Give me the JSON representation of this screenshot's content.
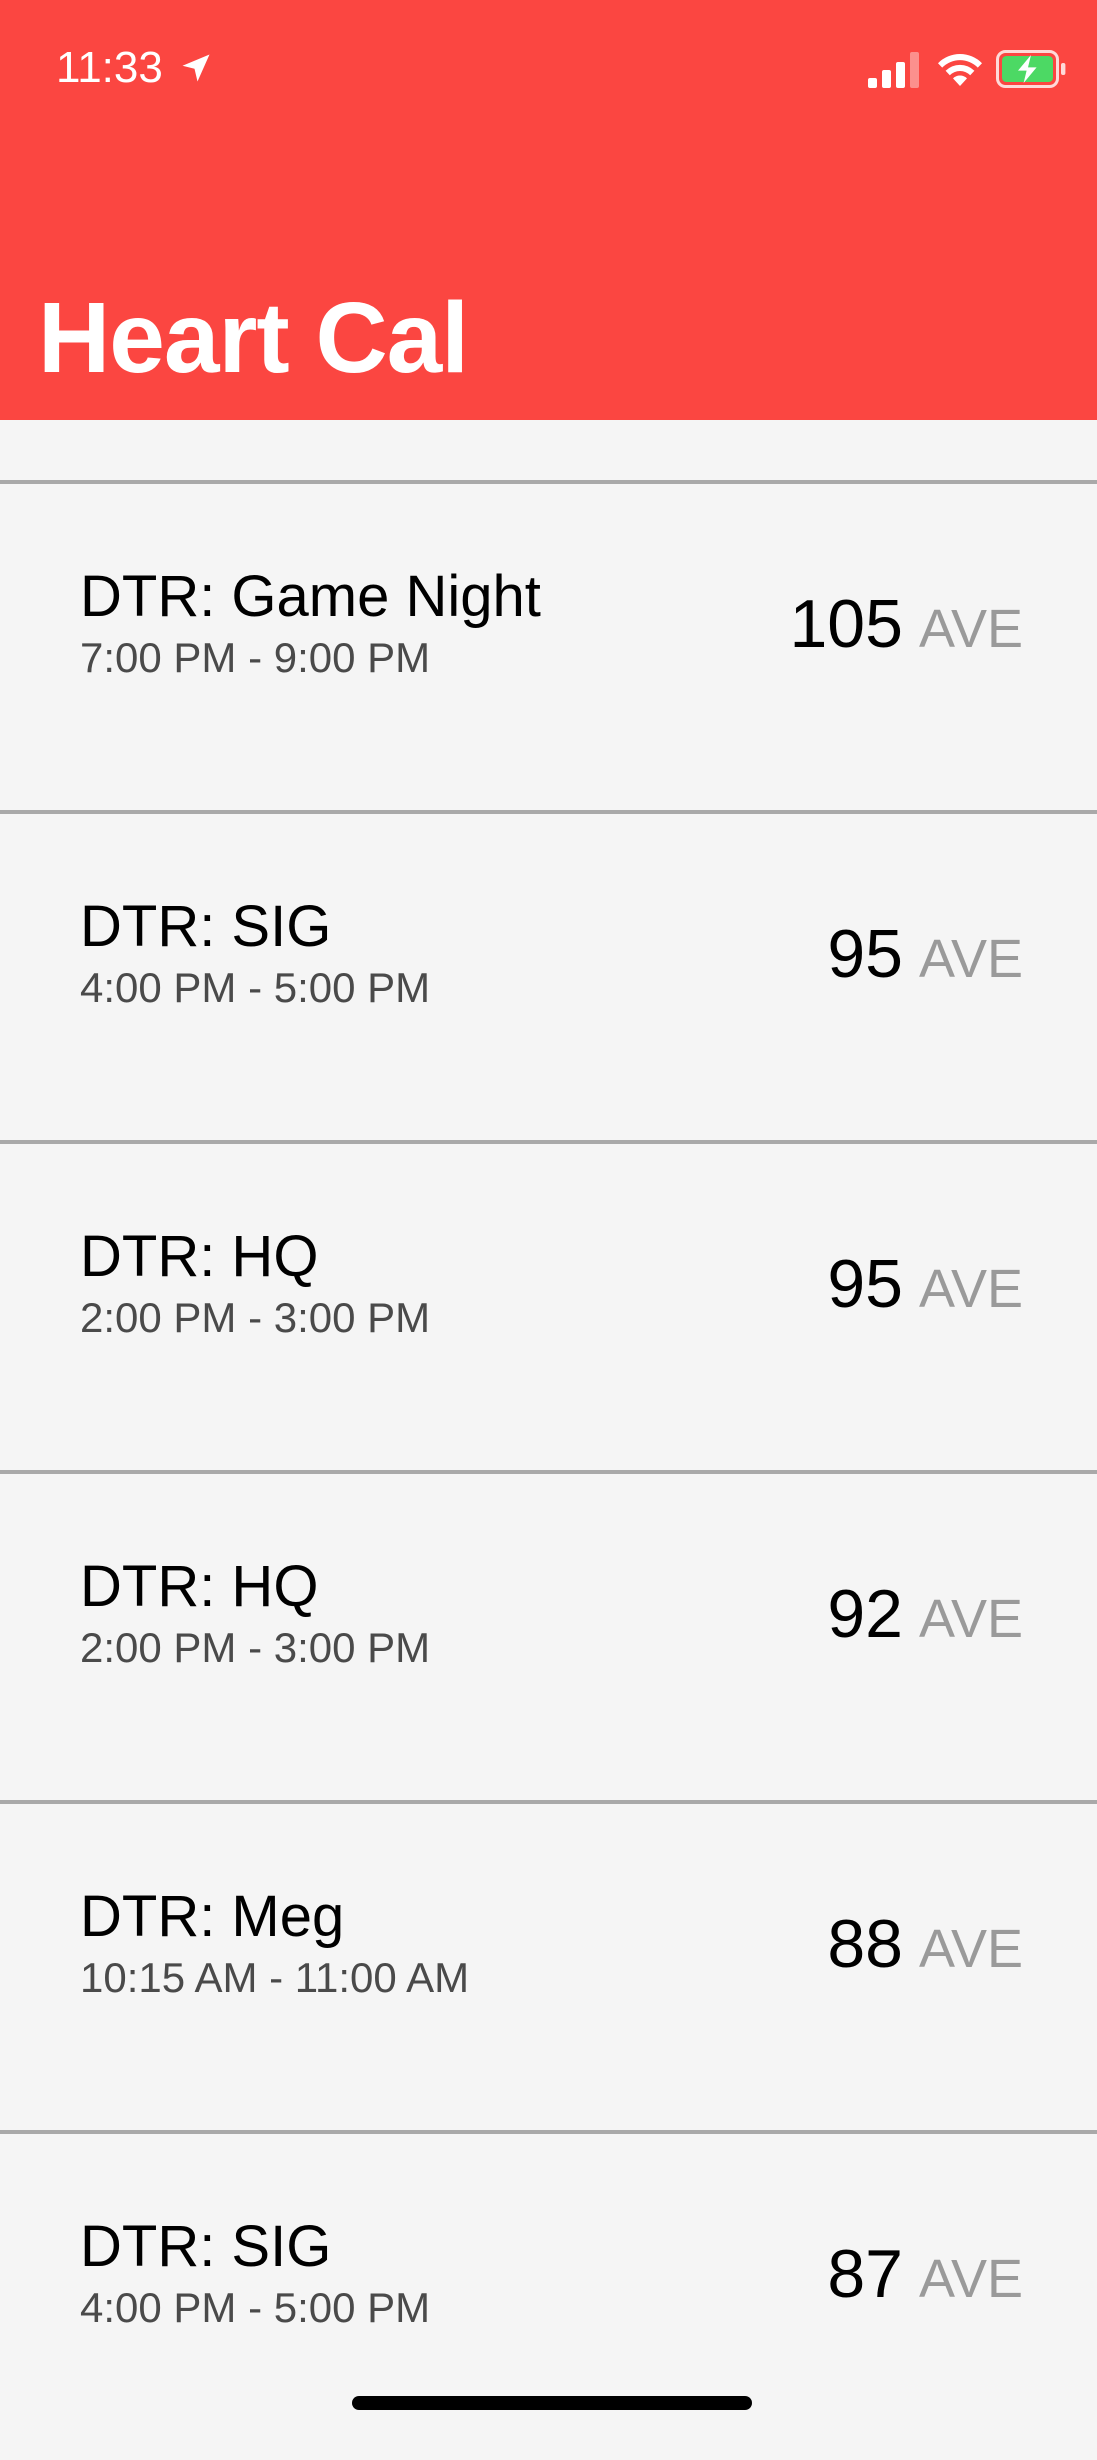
{
  "status_bar": {
    "time": "11:33",
    "icons": [
      "location-arrow-icon",
      "cellular-signal-icon",
      "wifi-icon",
      "battery-charging-icon"
    ]
  },
  "header": {
    "title": "Heart Cal",
    "background_color": "#fb4641"
  },
  "events": [
    {
      "title": "DTR: Game Night",
      "time": "7:00 PM - 9:00 PM",
      "value": "105",
      "unit": "AVE"
    },
    {
      "title": "DTR: SIG",
      "time": "4:00 PM - 5:00 PM",
      "value": "95",
      "unit": "AVE"
    },
    {
      "title": "DTR: HQ",
      "time": "2:00 PM - 3:00 PM",
      "value": "95",
      "unit": "AVE"
    },
    {
      "title": "DTR: HQ",
      "time": "2:00 PM - 3:00 PM",
      "value": "92",
      "unit": "AVE"
    },
    {
      "title": "DTR: Meg",
      "time": "10:15 AM - 11:00 AM",
      "value": "88",
      "unit": "AVE"
    },
    {
      "title": "DTR: SIG",
      "time": "4:00 PM - 5:00 PM",
      "value": "87",
      "unit": "AVE"
    }
  ]
}
